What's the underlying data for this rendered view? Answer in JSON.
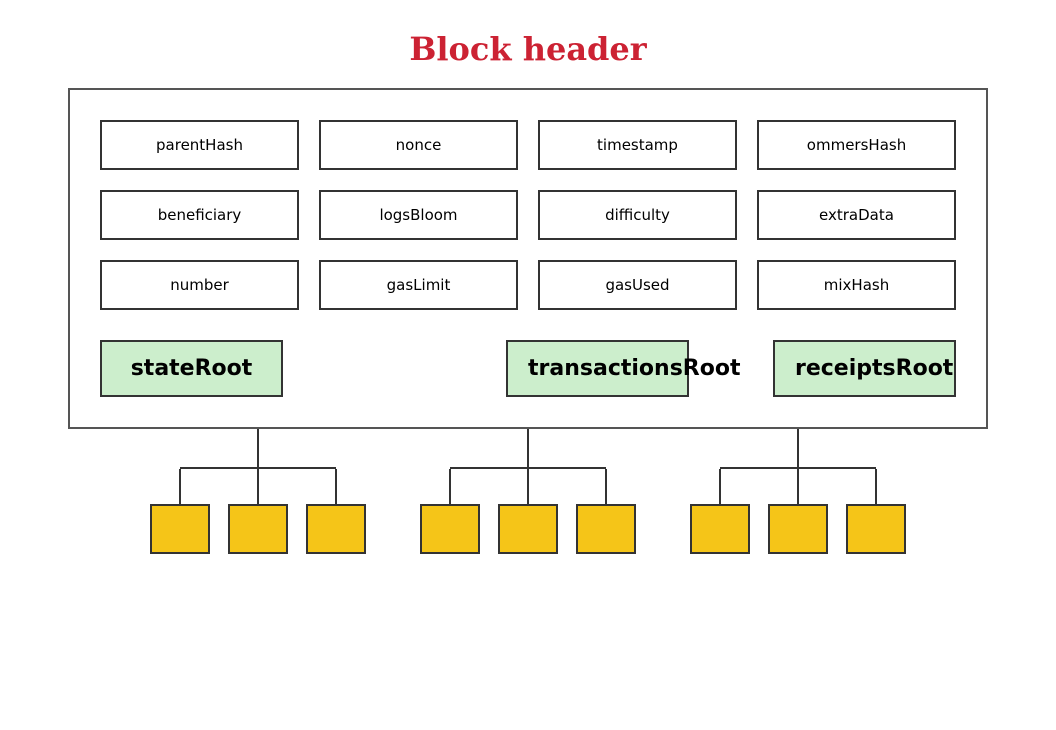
{
  "title": "Block header",
  "rows": [
    [
      "parentHash",
      "nonce",
      "timestamp",
      "ommersHash"
    ],
    [
      "beneficiary",
      "logsBloom",
      "difficulty",
      "extraData"
    ],
    [
      "number",
      "gasLimit",
      "gasUsed",
      "mixHash"
    ]
  ],
  "roots": [
    "stateRoot",
    "transactionsRoot",
    "receiptsRoot"
  ],
  "leaf_count": 3,
  "colors": {
    "title": "#cc2233",
    "root_bg": "#cceecc",
    "leaf_bg": "#f5c518",
    "border": "#333333"
  }
}
